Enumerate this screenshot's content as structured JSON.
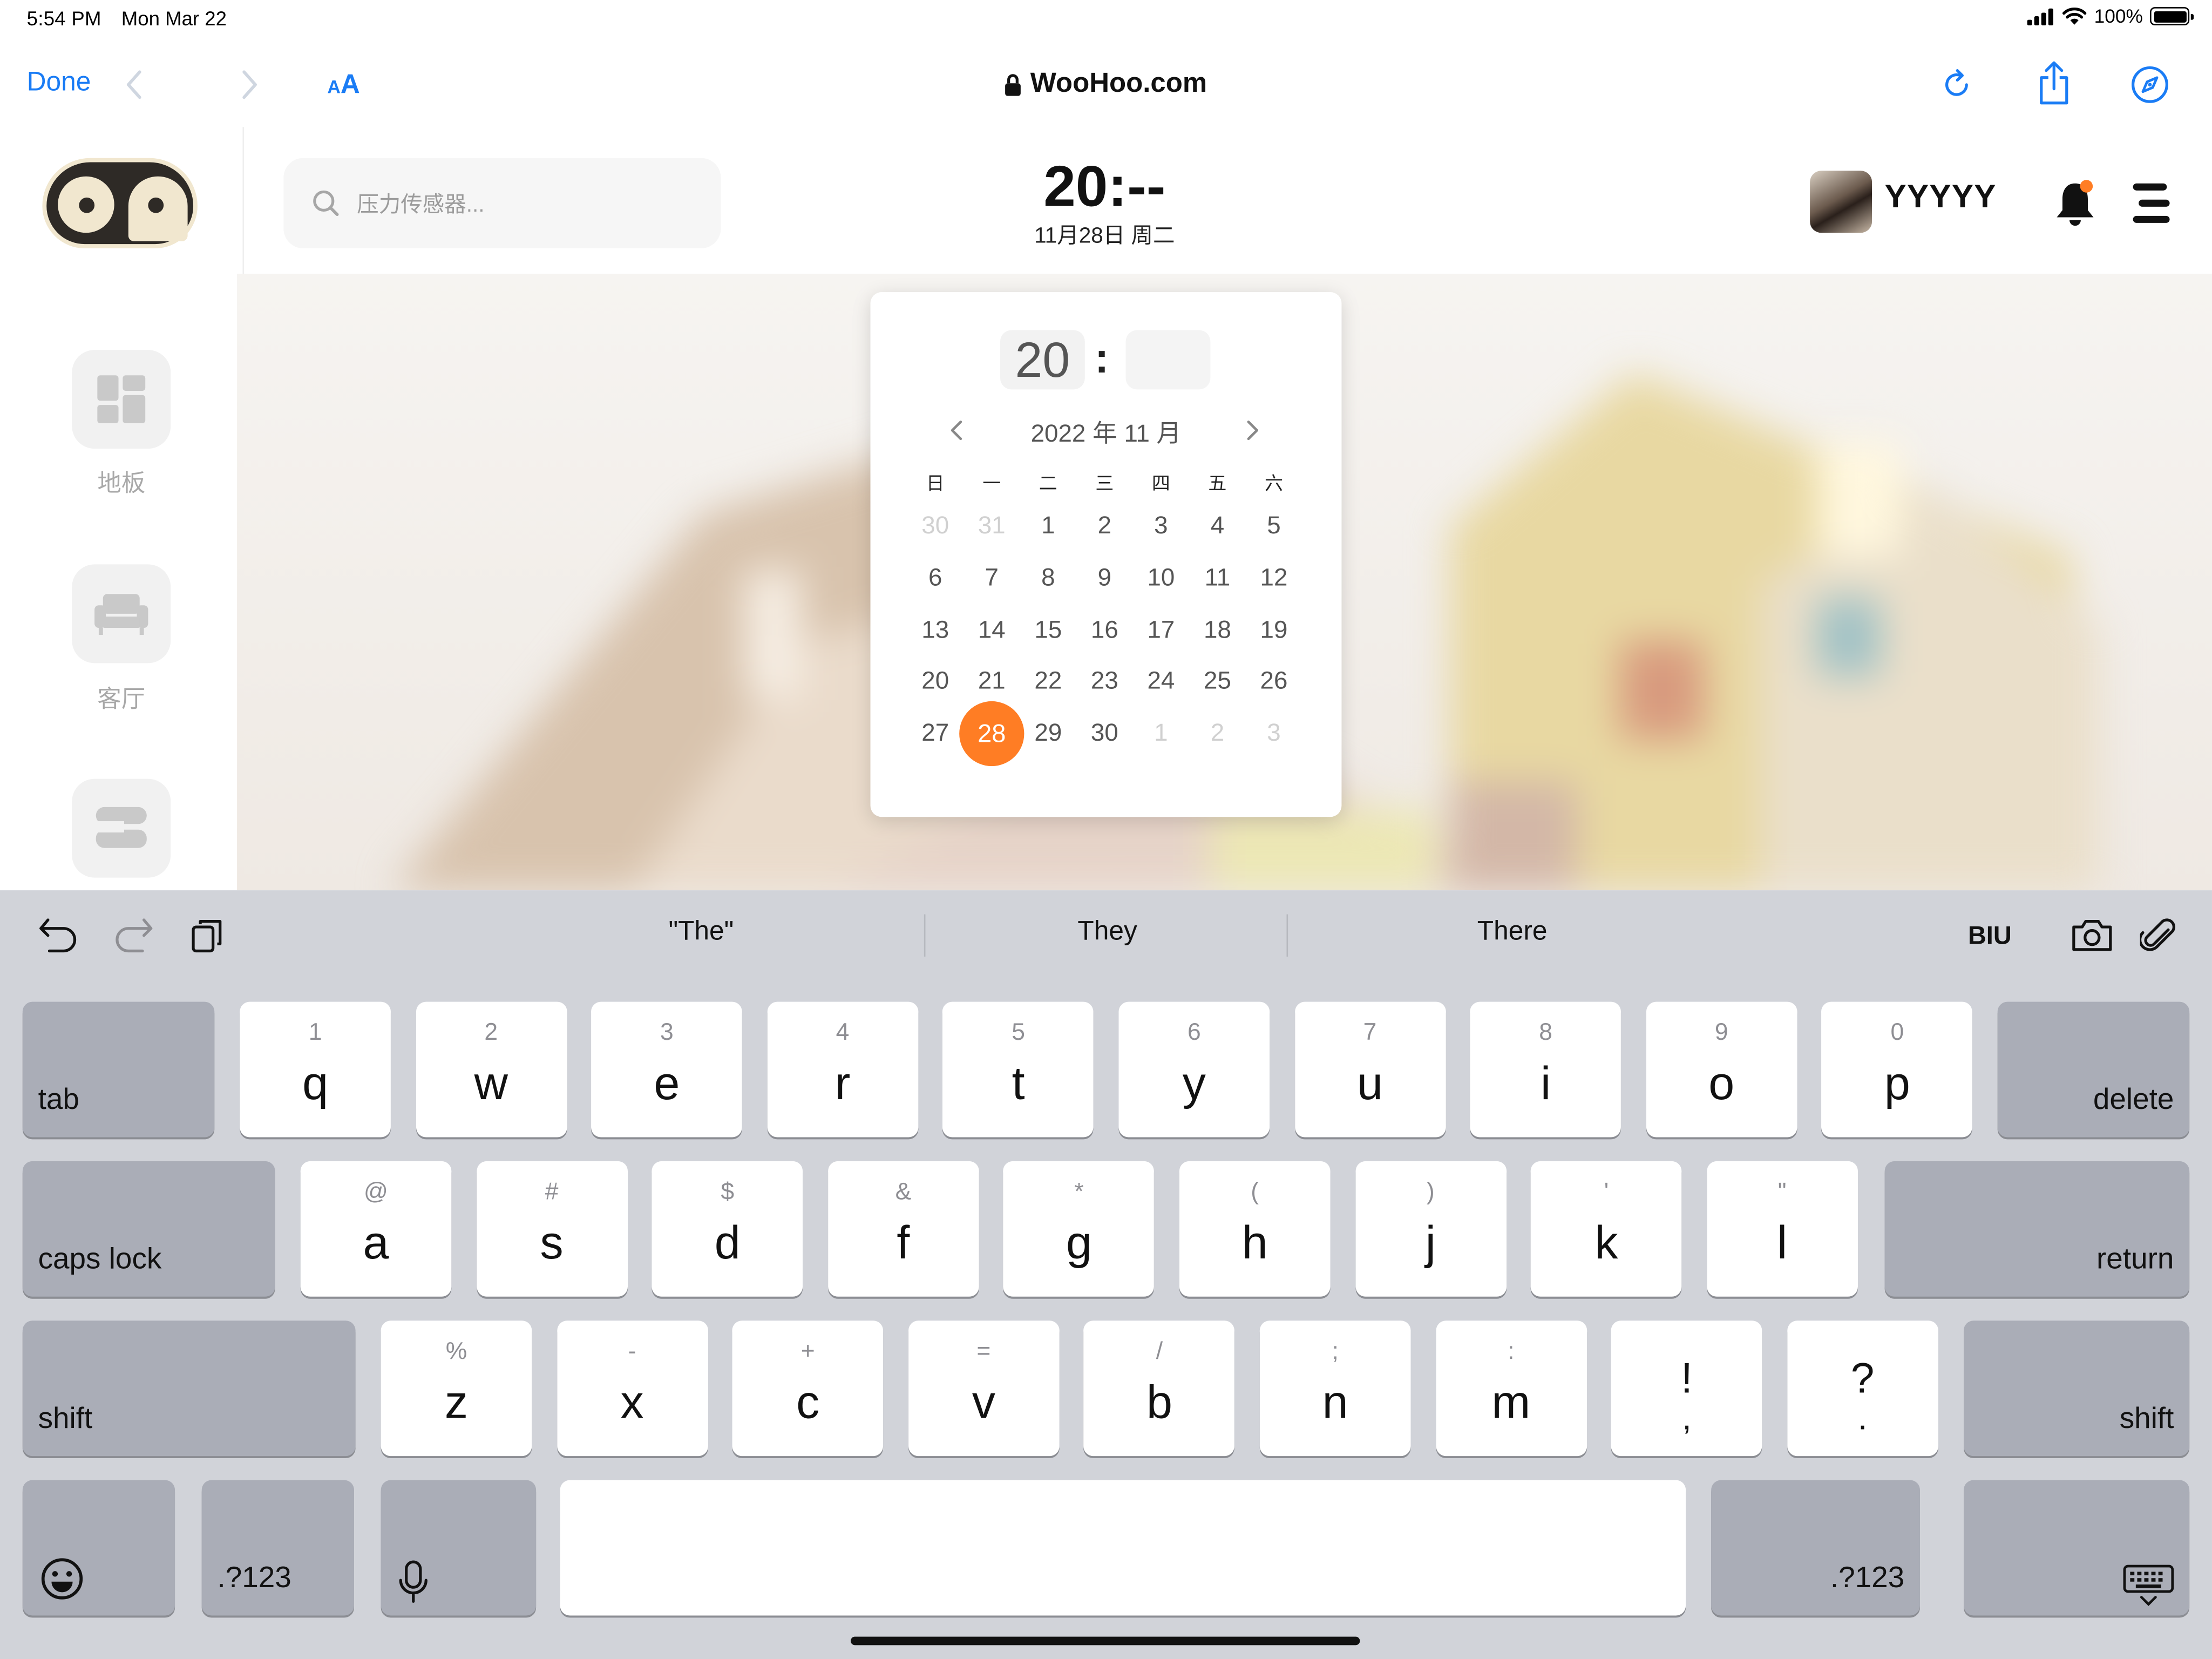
{
  "status": {
    "time": "5:54 PM",
    "date": "Mon Mar 22",
    "battery": "100%"
  },
  "browser": {
    "done": "Done",
    "aa_small": "A",
    "aa_big": "A",
    "url": "WooHoo.com"
  },
  "sidebar": {
    "items": [
      {
        "label": "地板",
        "icon": "floor-grid-icon"
      },
      {
        "label": "客厅",
        "icon": "sofa-icon"
      },
      {
        "label": "",
        "icon": "stack-icon"
      }
    ]
  },
  "header": {
    "search_placeholder": "压力传感器...",
    "time": "20:--",
    "date": "11月28日 周二",
    "username": "YYYYY"
  },
  "picker": {
    "hour": "20",
    "colon": ":",
    "minute": "",
    "month_label": "2022 年 11 月",
    "weekdays": [
      "日",
      "一",
      "二",
      "三",
      "四",
      "五",
      "六"
    ],
    "weeks": [
      [
        "30",
        "31",
        "1",
        "2",
        "3",
        "4",
        "5"
      ],
      [
        "6",
        "7",
        "8",
        "9",
        "10",
        "11",
        "12"
      ],
      [
        "13",
        "14",
        "15",
        "16",
        "17",
        "18",
        "19"
      ],
      [
        "20",
        "21",
        "22",
        "23",
        "24",
        "25",
        "26"
      ],
      [
        "27",
        "28",
        "29",
        "30",
        "1",
        "2",
        "3"
      ]
    ],
    "selected": "28",
    "accent": "#ff7d24"
  },
  "keyboard": {
    "suggestions": [
      "\"The\"",
      "They",
      "There"
    ],
    "format_label": "BIU",
    "row1": [
      {
        "m": "q",
        "s": "1"
      },
      {
        "m": "w",
        "s": "2"
      },
      {
        "m": "e",
        "s": "3"
      },
      {
        "m": "r",
        "s": "4"
      },
      {
        "m": "t",
        "s": "5"
      },
      {
        "m": "y",
        "s": "6"
      },
      {
        "m": "u",
        "s": "7"
      },
      {
        "m": "i",
        "s": "8"
      },
      {
        "m": "o",
        "s": "9"
      },
      {
        "m": "p",
        "s": "0"
      }
    ],
    "row2": [
      {
        "m": "a",
        "s": "@"
      },
      {
        "m": "s",
        "s": "#"
      },
      {
        "m": "d",
        "s": "$"
      },
      {
        "m": "f",
        "s": "&"
      },
      {
        "m": "g",
        "s": "*"
      },
      {
        "m": "h",
        "s": "("
      },
      {
        "m": "j",
        "s": ")"
      },
      {
        "m": "k",
        "s": "'"
      },
      {
        "m": "l",
        "s": "\""
      }
    ],
    "row3": [
      {
        "m": "z",
        "s": "%"
      },
      {
        "m": "x",
        "s": "-"
      },
      {
        "m": "c",
        "s": "+"
      },
      {
        "m": "v",
        "s": "="
      },
      {
        "m": "b",
        "s": "/"
      },
      {
        "m": "n",
        "s": ";"
      },
      {
        "m": "m",
        "s": ":"
      },
      {
        "m": "!",
        "s": ","
      },
      {
        "m": "?",
        "s": "."
      }
    ],
    "tab": "tab",
    "delete": "delete",
    "caps": "caps lock",
    "return": "return",
    "shift": "shift",
    "numbers": ".?123"
  }
}
